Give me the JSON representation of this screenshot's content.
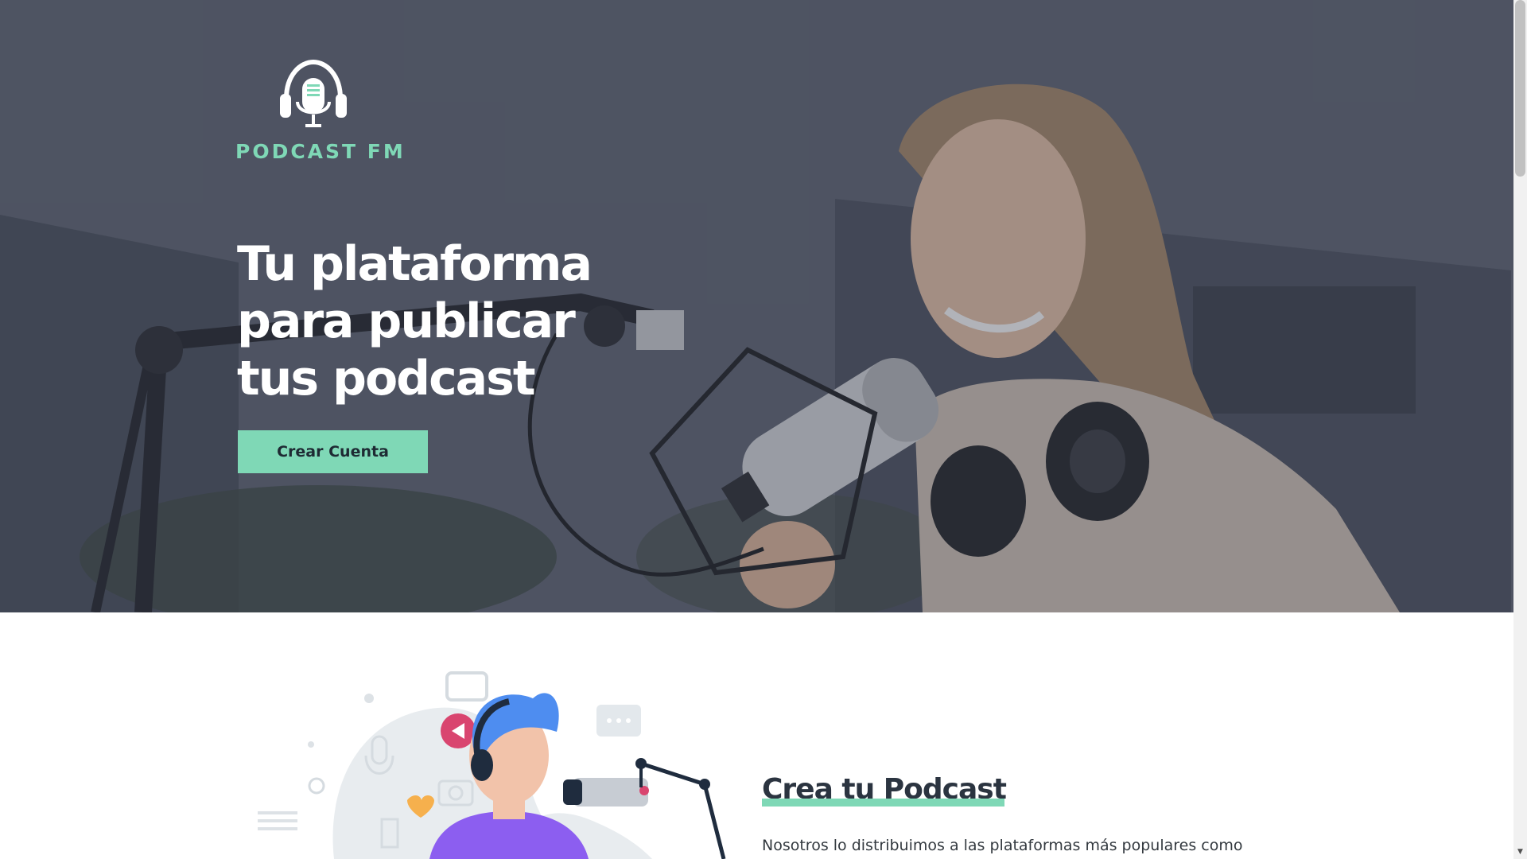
{
  "hero": {
    "logo_text": "PODCAST FM",
    "title_lines": [
      "Tu plataforma",
      "para publicar",
      "tus podcast"
    ],
    "cta_label": "Crear Cuenta"
  },
  "section": {
    "title": "Crea tu Podcast",
    "text": "Nosotros lo distribuimos a las plataformas más populares como"
  },
  "colors": {
    "accent": "#7fd8b6",
    "dark_text": "#2b3440",
    "hero_overlay": "#5a6170"
  },
  "icons": {
    "logo": "headphones-microphone-icon",
    "illustration": "podcaster-illustration"
  }
}
